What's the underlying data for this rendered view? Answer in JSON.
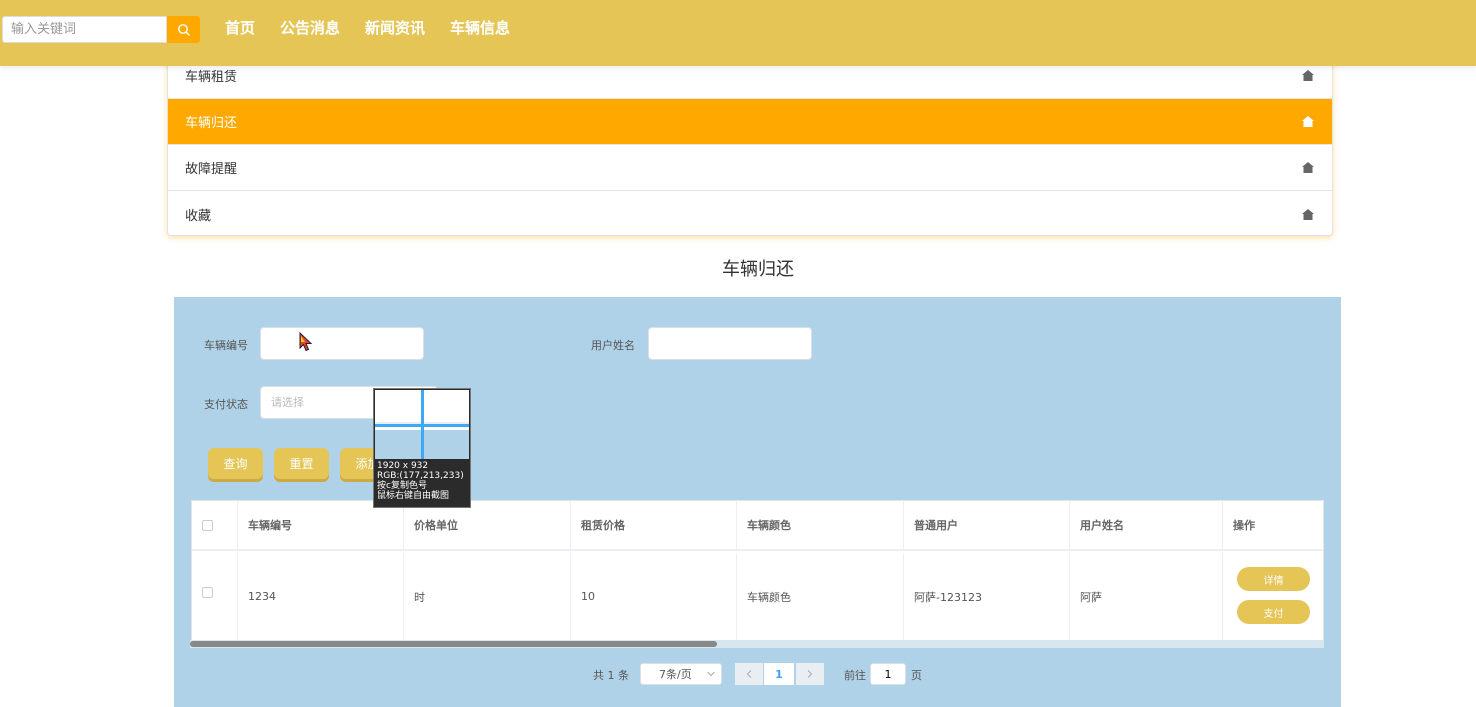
{
  "search": {
    "placeholder": "输入关键词"
  },
  "nav": {
    "items": [
      "首页",
      "公告消息",
      "新闻资讯",
      "车辆信息"
    ]
  },
  "menu": {
    "items": [
      {
        "label": "车辆租赁",
        "active": false
      },
      {
        "label": "车辆归还",
        "active": true
      },
      {
        "label": "故障提醒",
        "active": false
      },
      {
        "label": "收藏",
        "active": false
      }
    ]
  },
  "page": {
    "title": "车辆归还"
  },
  "form": {
    "vehicle_no_label": "车辆编号",
    "vehicle_no_value": "",
    "username_label": "用户姓名",
    "username_value": "",
    "pay_status_label": "支付状态",
    "pay_status_placeholder": "请选择",
    "query_button": "查询",
    "reset_button": "重置",
    "add_button": "添加"
  },
  "table": {
    "columns": [
      "车辆编号",
      "价格单位",
      "租赁价格",
      "车辆颜色",
      "普通用户",
      "用户姓名",
      "操作"
    ],
    "rows": [
      {
        "cells": [
          "1234",
          "时",
          "10",
          "车辆颜色",
          "阿萨-123123",
          "阿萨"
        ],
        "actions": [
          "详情",
          "支付"
        ]
      }
    ]
  },
  "pagination": {
    "total_text": "共 1 条",
    "page_size": "7条/页",
    "current_page": "1",
    "goto_label": "前往",
    "goto_value": "1",
    "page_suffix": "页"
  },
  "color_picker": {
    "size": "1920 x 932",
    "rgb": "RGB:(177,213,233)",
    "hint_copy": "按c复制色号",
    "hint_capture": "鼠标右键自由截图"
  },
  "colors": {
    "topbar": "#e4c556",
    "accent": "#ffa800",
    "panel": "#afd2e9",
    "button": "#e4c556"
  }
}
